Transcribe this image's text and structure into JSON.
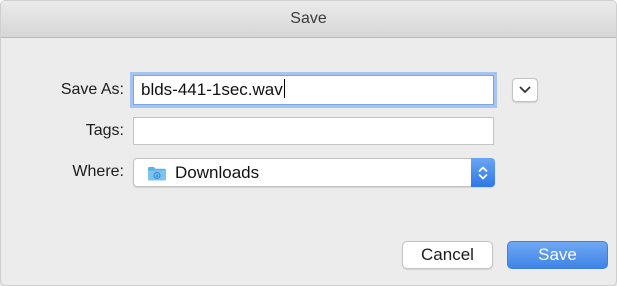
{
  "window": {
    "title": "Save"
  },
  "form": {
    "save_as_label": "Save As:",
    "save_as_value": "blds-441-1sec.wav",
    "tags_label": "Tags:",
    "tags_value": "",
    "where_label": "Where:",
    "where_value": "Downloads"
  },
  "icons": {
    "expand": "chevron-down-icon",
    "folder": "downloads-folder-icon",
    "stepper": "up-down-chevron-icon"
  },
  "buttons": {
    "cancel_label": "Cancel",
    "save_label": "Save"
  },
  "colors": {
    "accent": "#3f84e8",
    "focus_ring": "#a5c5f0",
    "folder": "#5fb0e8"
  }
}
